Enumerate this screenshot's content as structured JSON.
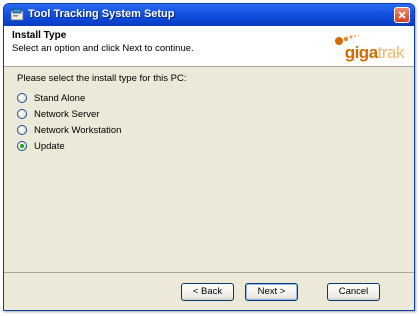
{
  "window": {
    "title": "Tool Tracking System Setup"
  },
  "header": {
    "title": "Install Type",
    "subtitle": "Select an option and click Next to continue.",
    "logo_dark": "giga",
    "logo_light": "trak"
  },
  "main": {
    "prompt": "Please select the install type for this PC:",
    "options": [
      {
        "label": "Stand Alone",
        "selected": false
      },
      {
        "label": "Network Server",
        "selected": false
      },
      {
        "label": "Network Workstation",
        "selected": false
      },
      {
        "label": "Update",
        "selected": true
      }
    ]
  },
  "buttons": {
    "back": "< Back",
    "next": "Next >",
    "cancel": "Cancel"
  },
  "colors": {
    "titlebar": "#1656e4",
    "dialog_bg": "#ece9d8",
    "logo_orange": "#d46a00",
    "radio_selected": "#21a121"
  }
}
